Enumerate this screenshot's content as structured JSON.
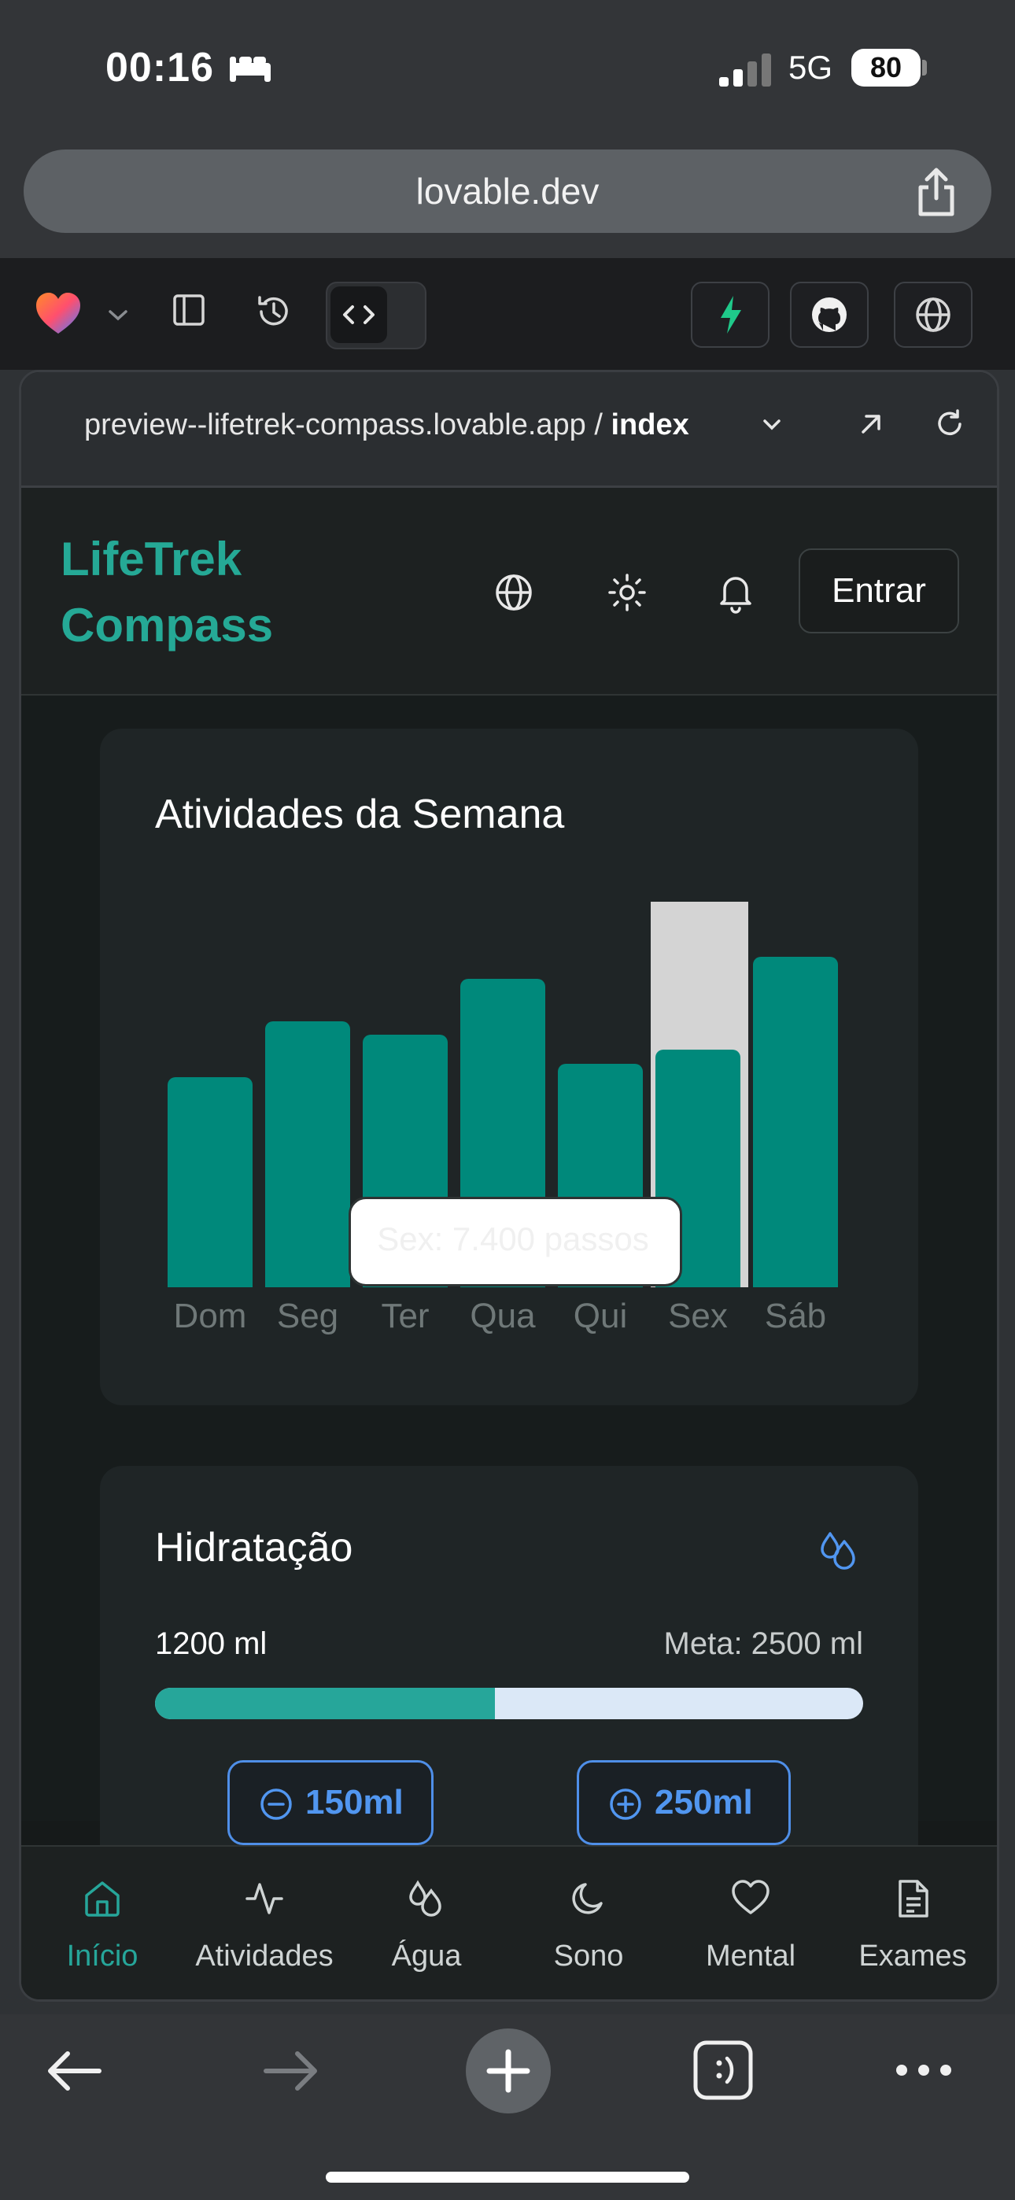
{
  "status_bar": {
    "time": "00:16",
    "network": "5G",
    "battery": "80"
  },
  "browser": {
    "url": "lovable.dev"
  },
  "preview": {
    "address": "preview--lifetrek-compass.lovable.app / ",
    "page": "index"
  },
  "app": {
    "logo_line1": "LifeTrek",
    "logo_line2": "Compass",
    "login_label": "Entrar",
    "accent_color": "#25a996"
  },
  "weekly_card": {
    "title": "Atividades da Semana",
    "tooltip": "Sex: 7.400 passos",
    "highlighted": "Sex"
  },
  "chart_data": {
    "type": "bar",
    "title": "Atividades da Semana",
    "categories": [
      "Dom",
      "Seg",
      "Ter",
      "Qua",
      "Qui",
      "Sex",
      "Sáb"
    ],
    "values": [
      5450,
      6900,
      6550,
      8000,
      5800,
      6170,
      8580
    ],
    "highlight_index": 5,
    "ylim": [
      0,
      10000
    ],
    "grid": false,
    "legend": "none",
    "bar_color": "#00897b",
    "highlight_color": "#d4d4d4"
  },
  "hydration": {
    "title": "Hidratação",
    "current": "1200 ml",
    "goal": "Meta: 2500 ml",
    "progress": 0.48,
    "minus_label": "150ml",
    "plus_label": "250ml",
    "accent_color": "#5196f0"
  },
  "bottom_nav": [
    {
      "label": "Início",
      "icon": "home-icon",
      "active": true
    },
    {
      "label": "Atividades",
      "icon": "activity-icon",
      "active": false
    },
    {
      "label": "Água",
      "icon": "droplets-icon",
      "active": false
    },
    {
      "label": "Sono",
      "icon": "moon-icon",
      "active": false
    },
    {
      "label": "Mental",
      "icon": "heart-icon",
      "active": false
    },
    {
      "label": "Exames",
      "icon": "file-text-icon",
      "active": false
    }
  ]
}
